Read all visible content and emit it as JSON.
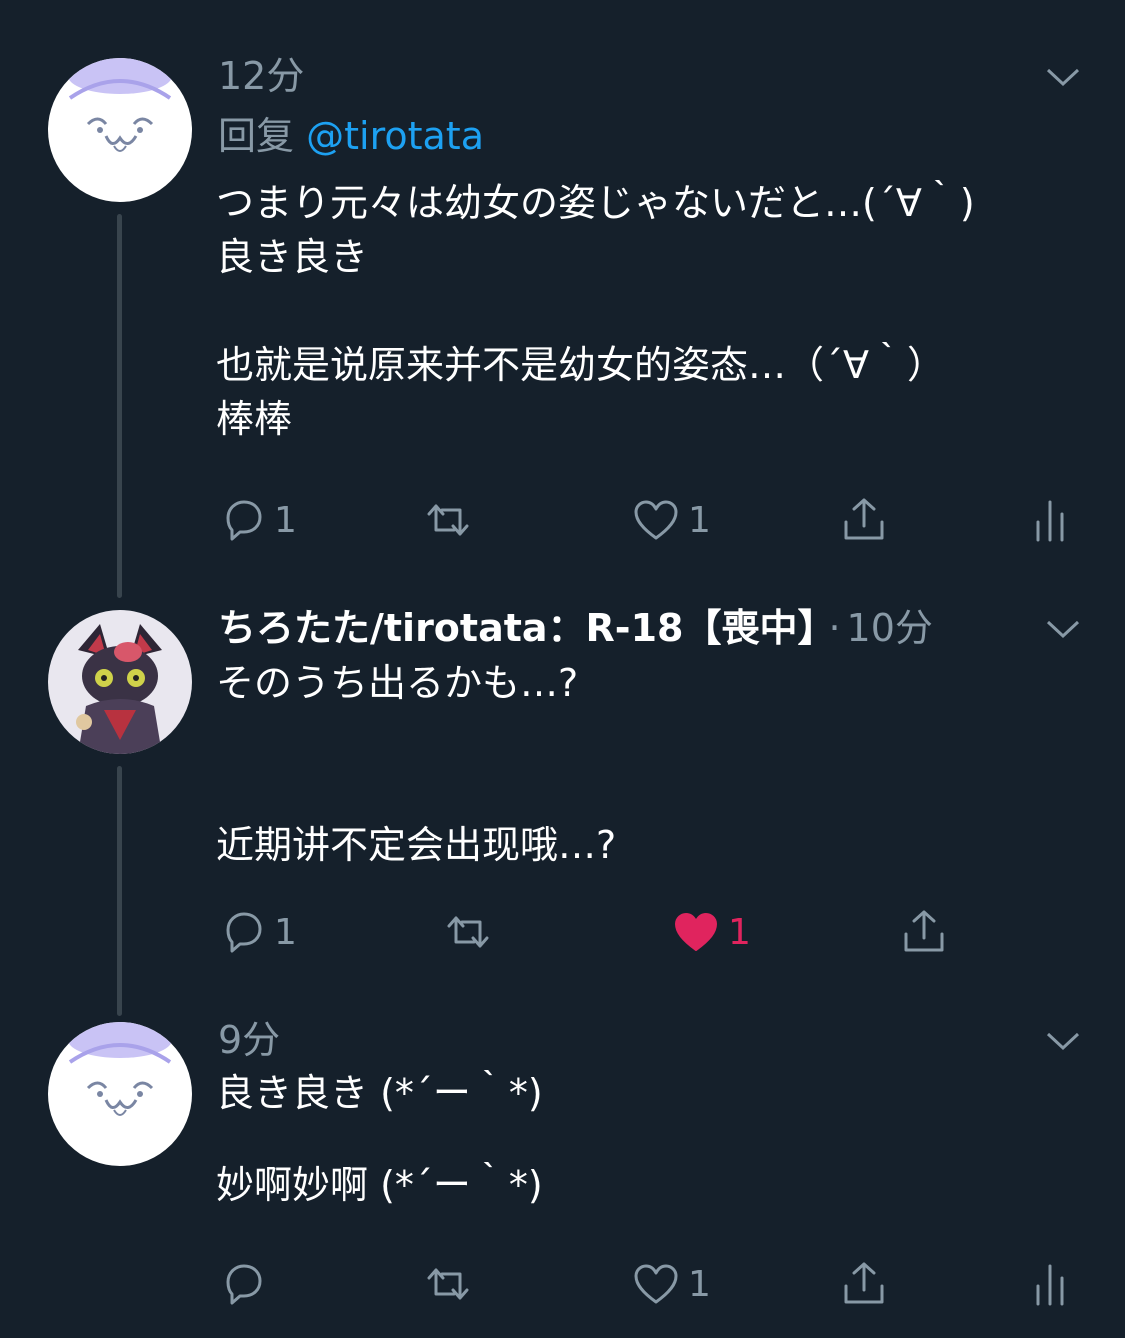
{
  "colors": {
    "background": "#15202b",
    "secondary_text": "#8899a6",
    "link": "#1da1f2",
    "like_active": "#e0245e",
    "thread_line": "#38444d"
  },
  "tweets": [
    {
      "avatar": "white-seal-avatar",
      "time": "12分",
      "reply_prefix": "回复",
      "reply_handle": "@tirotata",
      "body": "つまり元々は幼女の姿じゃないだと…(´∀｀)\n良き良き\n\n也就是说原来并不是幼女的姿态…（´∀｀）\n棒棒",
      "actions": {
        "reply_count": "1",
        "retweet_count": "",
        "like_count": "1",
        "liked": false,
        "show_analytics": true
      }
    },
    {
      "avatar": "character-avatar",
      "author_name": "ちろたた/tirotata：R-18【喪中】",
      "dot": "·",
      "time": "10分",
      "body": "そのうち出るかも…?\n\n\n近期讲不定会出现哦…?",
      "actions": {
        "reply_count": "1",
        "retweet_count": "",
        "like_count": "1",
        "liked": true,
        "show_analytics": false
      }
    },
    {
      "avatar": "white-seal-avatar",
      "time": "9分",
      "body": "良き良き (*´ー｀*)\n\n妙啊妙啊 (*´ー｀*)",
      "actions": {
        "reply_count": "",
        "retweet_count": "",
        "like_count": "1",
        "liked": false,
        "show_analytics": true
      }
    }
  ]
}
